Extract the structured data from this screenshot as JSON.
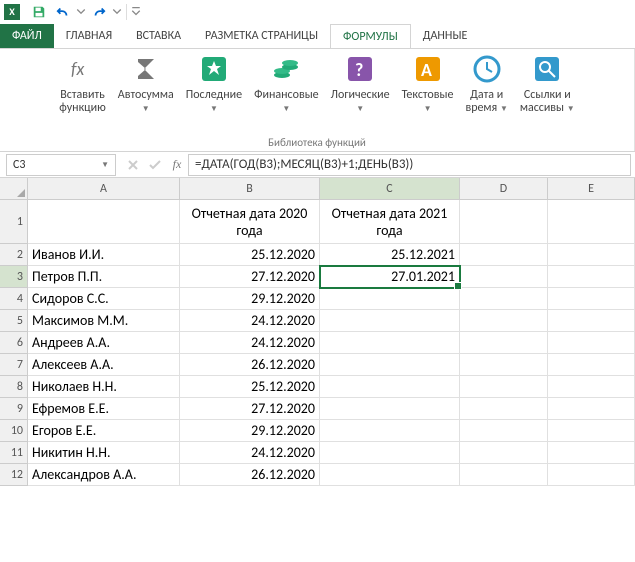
{
  "qat": {
    "app": "X"
  },
  "tabs": {
    "file": "ФАЙЛ",
    "home": "ГЛАВНАЯ",
    "insert": "ВСТАВКА",
    "layout": "РАЗМЕТКА СТРАНИЦЫ",
    "formulas": "ФОРМУЛЫ",
    "data": "ДАННЫЕ"
  },
  "ribbon": {
    "insertfn_l1": "Вставить",
    "insertfn_l2": "функцию",
    "autosum": "Автосумма",
    "recent": "Последние",
    "financial": "Финансовые",
    "logical": "Логические",
    "text": "Текстовые",
    "datetime_l1": "Дата и",
    "datetime_l2": "время",
    "lookup_l1": "Ссылки и",
    "lookup_l2": "массивы",
    "group_label": "Библиотека функций"
  },
  "namebox": "C3",
  "formula": "=ДАТА(ГОД(B3);МЕСЯЦ(B3)+1;ДЕНЬ(B3))",
  "cols": [
    "A",
    "B",
    "C",
    "D",
    "E"
  ],
  "headers": {
    "b": "Отчетная дата 2020 года",
    "c": "Отчетная дата 2021 года"
  },
  "rows": [
    {
      "n": "2",
      "a": "Иванов И.И.",
      "b": "25.12.2020",
      "c": "25.12.2021"
    },
    {
      "n": "3",
      "a": "Петров П.П.",
      "b": "27.12.2020",
      "c": "27.01.2021"
    },
    {
      "n": "4",
      "a": "Сидоров С.С.",
      "b": "29.12.2020",
      "c": ""
    },
    {
      "n": "5",
      "a": "Максимов М.М.",
      "b": "24.12.2020",
      "c": ""
    },
    {
      "n": "6",
      "a": "Андреев А.А.",
      "b": "24.12.2020",
      "c": ""
    },
    {
      "n": "7",
      "a": "Алексеев А.А.",
      "b": "26.12.2020",
      "c": ""
    },
    {
      "n": "8",
      "a": "Николаев Н.Н.",
      "b": "25.12.2020",
      "c": ""
    },
    {
      "n": "9",
      "a": "Ефремов Е.Е.",
      "b": "27.12.2020",
      "c": ""
    },
    {
      "n": "10",
      "a": "Егоров Е.Е.",
      "b": "29.12.2020",
      "c": ""
    },
    {
      "n": "11",
      "a": "Никитин Н.Н.",
      "b": "24.12.2020",
      "c": ""
    },
    {
      "n": "12",
      "a": "Александров А.А.",
      "b": "26.12.2020",
      "c": ""
    }
  ],
  "row1": "1"
}
